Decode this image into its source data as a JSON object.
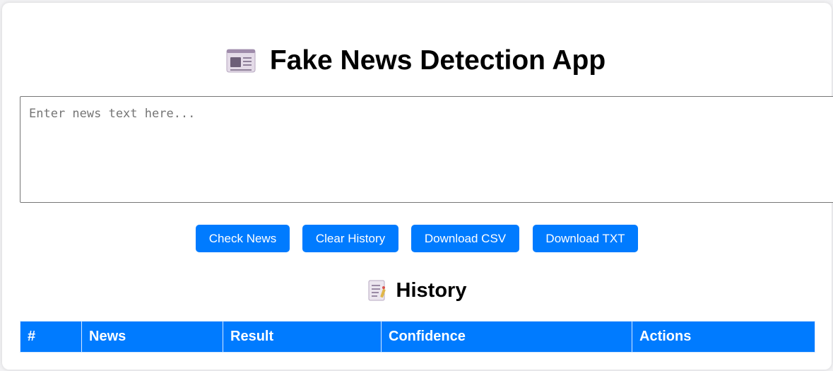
{
  "app": {
    "title": "Fake News Detection App",
    "title_icon": "newspaper-icon"
  },
  "input": {
    "placeholder": "Enter news text here...",
    "value": ""
  },
  "buttons": {
    "check": "Check News",
    "clear": "Clear History",
    "csv": "Download CSV",
    "txt": "Download TXT"
  },
  "history": {
    "title": "History",
    "icon": "notepad-icon",
    "columns": [
      "#",
      "News",
      "Result",
      "Confidence",
      "Actions"
    ],
    "rows": []
  },
  "colors": {
    "accent": "#007bff",
    "background": "#f2f2f4",
    "card": "#ffffff"
  }
}
